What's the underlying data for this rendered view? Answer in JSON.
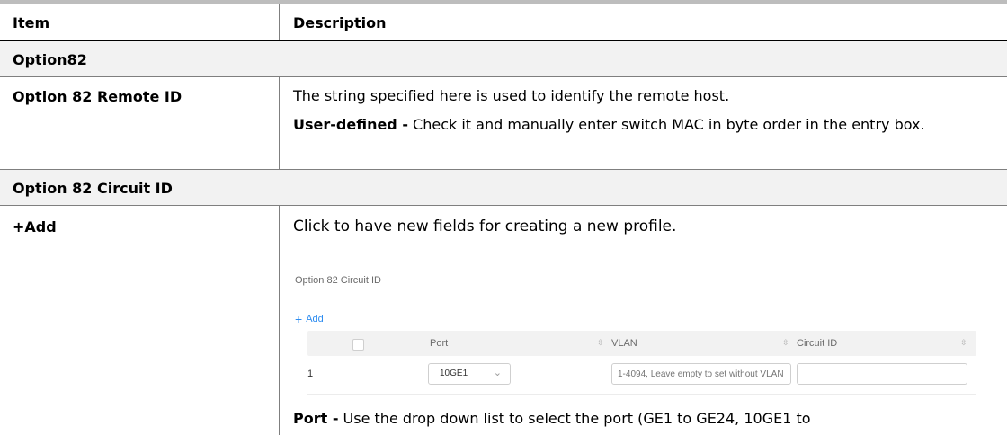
{
  "header": {
    "item": "Item",
    "description": "Description"
  },
  "sections": {
    "option82": "Option82",
    "circuit_id": "Option 82 Circuit ID"
  },
  "rows": {
    "remote_id": {
      "item": "Option 82 Remote ID",
      "desc1": "The string specified here is used to identify the remote host.",
      "desc2_bold": "User-defined -",
      "desc2": " Check it and manually enter switch MAC in byte order in the entry box."
    },
    "add": {
      "item": "+Add",
      "desc1": "Click to have new fields for creating a new profile.",
      "port_bold": "Port -",
      "port_desc": " Use the drop down list to select the port (GE1 to GE24, 10GE1 to"
    }
  },
  "screenshot": {
    "title": "Option 82 Circuit ID",
    "add_label": "Add",
    "add_plus": "+",
    "columns": {
      "port": "Port",
      "vlan": "VLAN",
      "circuit_id": "Circuit ID"
    },
    "sort_glyph": "⇳",
    "row": {
      "index": "1",
      "port_value": "10GE1",
      "vlan_placeholder": "1-4094, Leave empty to set without VLAN",
      "circuit_id_value": ""
    },
    "colors": {
      "accent": "#2d8cf0",
      "header_bg": "#f2f2f2"
    }
  }
}
